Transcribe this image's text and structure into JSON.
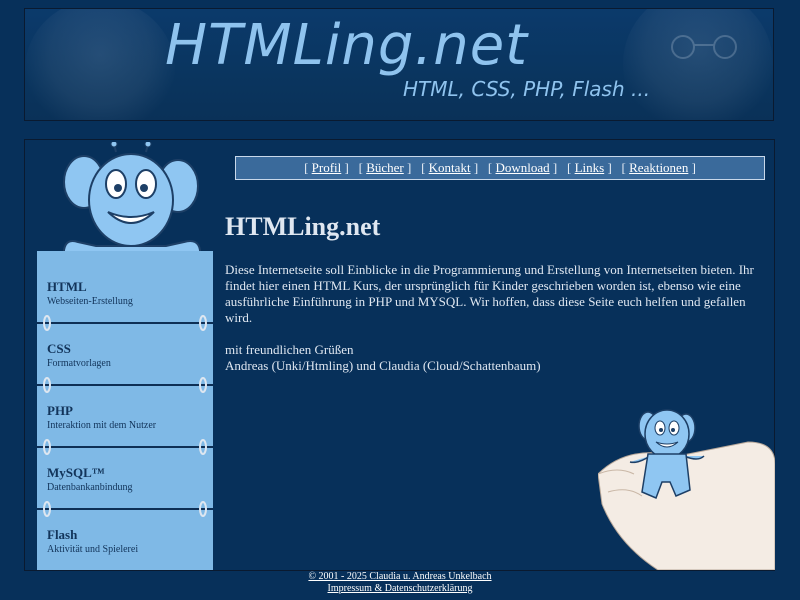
{
  "header": {
    "title": "HTMLing.net",
    "subtitle": "HTML, CSS, PHP, Flash ..."
  },
  "nav": {
    "items": [
      {
        "label": "Profil"
      },
      {
        "label": "Bücher"
      },
      {
        "label": "Kontakt"
      },
      {
        "label": "Download"
      },
      {
        "label": "Links"
      },
      {
        "label": "Reaktionen"
      }
    ]
  },
  "sidebar": {
    "items": [
      {
        "title": "HTML",
        "subtitle": "Webseiten-Erstellung"
      },
      {
        "title": "CSS",
        "subtitle": "Formatvorlagen"
      },
      {
        "title": "PHP",
        "subtitle": "Interaktion mit dem Nutzer"
      },
      {
        "title": "MySQL™",
        "subtitle": "Datenbankanbindung"
      },
      {
        "title": "Flash",
        "subtitle": "Aktivität und Spielerei"
      }
    ]
  },
  "content": {
    "title": "HTMLing.net",
    "intro": "Diese Internetseite soll Einblicke in die Programmierung und Erstellung von Internetseiten bieten. Ihr findet hier einen HTML Kurs, der ursprünglich für Kinder geschrieben worden ist, ebenso wie eine ausführliche Einführung in PHP und MYSQL. Wir hoffen, dass diese Seite euch helfen und gefallen wird.",
    "greeting": "mit freundlichen Grüßen",
    "authors": "Andreas (Unki/Htmling) und Claudia (Cloud/Schattenbaum)"
  },
  "footer": {
    "copyright": "© 2001 - 2025 Claudia u. Andreas Unkelbach",
    "legal": "Impressum & Datenschutzerklärung"
  },
  "colors": {
    "background": "#07305a",
    "sidebar": "#7fb9e6",
    "nav": "#3a6a9b",
    "title": "#8fc3ee"
  }
}
